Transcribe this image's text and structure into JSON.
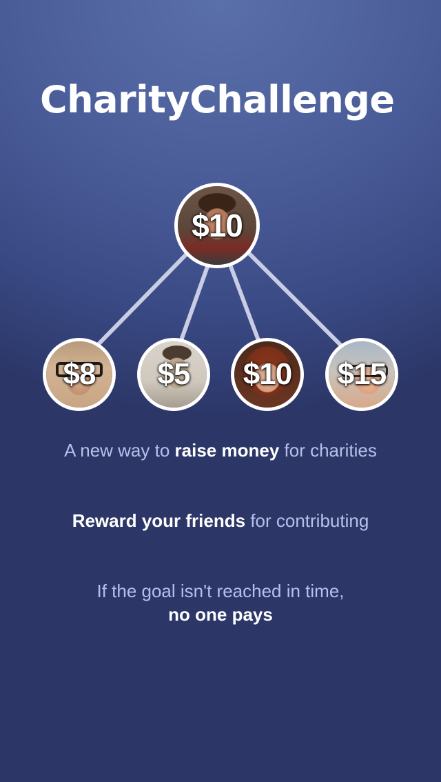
{
  "app": {
    "title": "CharityChallenge"
  },
  "tree": {
    "root": {
      "amount": "$10"
    },
    "children": [
      {
        "amount": "$8"
      },
      {
        "amount": "$5"
      },
      {
        "amount": "$10"
      },
      {
        "amount": "$15"
      }
    ]
  },
  "taglines": [
    {
      "pre": "A new way to ",
      "highlight": "raise money",
      "post": " for charities"
    },
    {
      "highlight": "Reward your friends",
      "post": " for contributing"
    },
    {
      "pre": "If the goal isn't reached in time,",
      "highlight": "no one pays"
    }
  ],
  "colors": {
    "background_top": "#5a70aa",
    "background_bottom": "#2c3768",
    "tagline_text": "#b7c0ea",
    "highlight_text": "#ffffff",
    "connector": "#c9cde3"
  }
}
